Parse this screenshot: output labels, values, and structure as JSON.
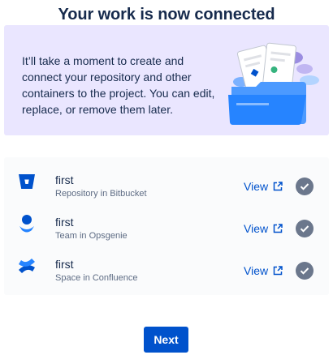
{
  "title": "Your work is now connected",
  "banner": {
    "text": "It’ll take a moment to create and connect your repository and other containers to the project. You can edit, replace, or remove them later.",
    "illustration_icon": "folder-documents-illustration"
  },
  "items": [
    {
      "name": "first",
      "subtitle": "Repository in Bitbucket",
      "icon": "bitbucket-icon",
      "link_label": "View",
      "status": "connected"
    },
    {
      "name": "first",
      "subtitle": "Team in Opsgenie",
      "icon": "opsgenie-icon",
      "link_label": "View",
      "status": "connected"
    },
    {
      "name": "first",
      "subtitle": "Space in Confluence",
      "icon": "confluence-icon",
      "link_label": "View",
      "status": "connected"
    }
  ],
  "next_label": "Next",
  "colors": {
    "primary": "#0052cc",
    "banner_bg": "#eae6ff",
    "check": "#6b778c",
    "text": "#172b4d",
    "subtle": "#5e6c84"
  }
}
